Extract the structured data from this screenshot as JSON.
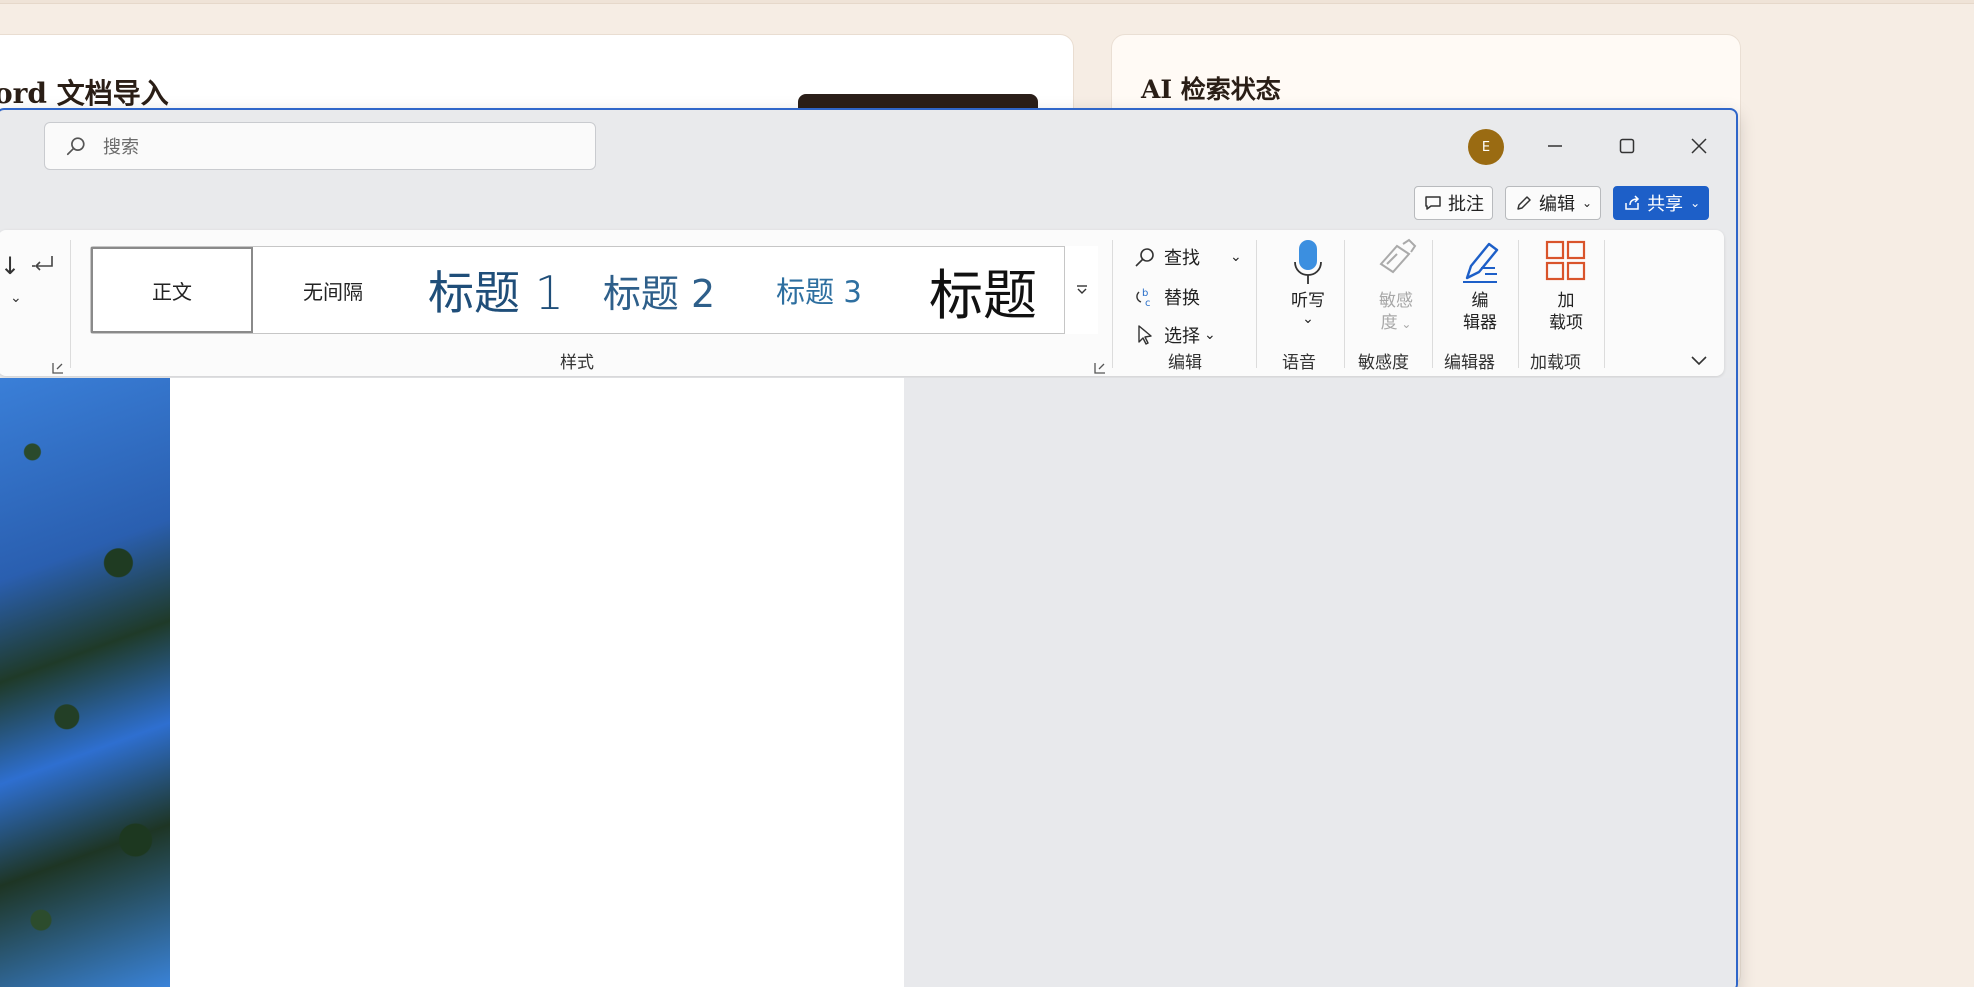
{
  "background": {
    "left_card_title": "ord 文档导入",
    "right_card_title": "AI 检索状态"
  },
  "titlebar": {
    "search_placeholder": "搜索",
    "avatar_initial": "E"
  },
  "actions": {
    "comment": "批注",
    "edit": "编辑",
    "share": "共享"
  },
  "ribbon": {
    "styles": {
      "items": [
        "正文",
        "无间隔",
        "标题 1",
        "标题 2",
        "标题 3",
        "标题"
      ],
      "label": "样式"
    },
    "editing": {
      "find": "查找",
      "replace": "替换",
      "select": "选择",
      "label": "编辑"
    },
    "voice": {
      "dictate": "听写",
      "label": "语音"
    },
    "sensitivity": {
      "button_line1": "敏感",
      "button_line2": "度",
      "label": "敏感度"
    },
    "editor": {
      "button_line1": "编",
      "button_line2": "辑器",
      "label": "编辑器"
    },
    "addins": {
      "button_line1": "加",
      "button_line2": "载项",
      "label": "加载项"
    }
  },
  "colors": {
    "accent": "#1d5fc8",
    "window_border": "#2f66c9",
    "heading_blue": "#1f4e79",
    "addins_orange": "#d9542b",
    "avatar": "#9a6b12"
  }
}
